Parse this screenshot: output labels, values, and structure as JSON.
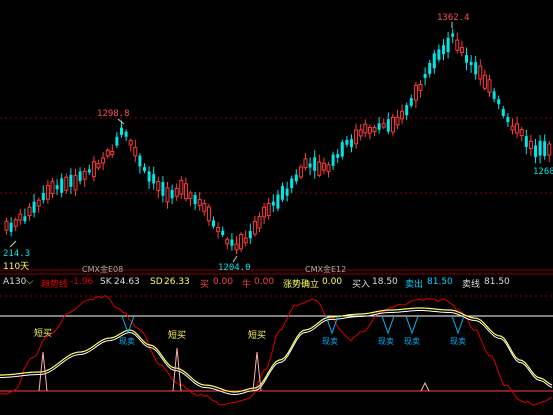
{
  "price_panel": {
    "peak_labels": {
      "high_1": "1298.8",
      "high_2": "1362.4",
      "low_1": "214.3",
      "low_2": "1204.0",
      "right_edge": "1268"
    },
    "period_label": "110天",
    "contract_labels": [
      "CMX金E08",
      "CMX金E12"
    ]
  },
  "indicator_header": {
    "name": "A130",
    "dropdown_glyph": "⌵",
    "trend_label": "趋势线",
    "trend_value": "-1.96",
    "sk_label": "SK",
    "sk_value": "24.63",
    "sd_label": "SD",
    "sd_value": "26.33",
    "buy_label": "买",
    "buy_value": "0.00",
    "bull_label": "牛",
    "bull_value": "0.00",
    "confirm_label": "涨势确立",
    "confirm_value": "0.00",
    "buyin_label": "买入",
    "buyin_value": "18.50",
    "sellout_label": "卖出",
    "sellout_value": "81.50",
    "sellline_label": "卖线",
    "sellline_value": "81.50"
  },
  "signal_labels": {
    "short_buy": "短买",
    "sell_marker": "现卖"
  },
  "colors": {
    "background": "#000000",
    "bull_candle": "#ff3b3b",
    "bear_candle": "#00e6e6",
    "grid": "#8b0000",
    "sk_line": "#ffff60",
    "sd_line": "#ffffff",
    "trend_line": "#e00000",
    "high_label": "#ff5050",
    "low_label": "#00e6e6"
  }
}
